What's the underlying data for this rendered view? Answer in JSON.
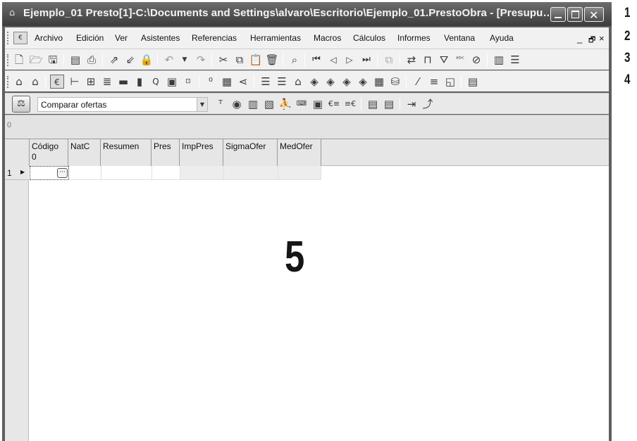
{
  "window": {
    "title": "Ejemplo_01 Presto[1]-C:\\Documents and Settings\\alvaro\\Escritorio\\Ejemplo_01.PrestoObra - [Presupu…"
  },
  "menubar": {
    "items": [
      "Archivo",
      "Edición",
      "Ver",
      "Asistentes",
      "Referencias",
      "Herramientas",
      "Macros",
      "Cálculos",
      "Informes",
      "Ventana",
      "Ayuda"
    ],
    "mdi_controls": [
      "_",
      "🗗",
      "×"
    ]
  },
  "toolbar_compare": {
    "selected": "Comparar ofertas"
  },
  "filter": {
    "value": "0"
  },
  "grid": {
    "columns": [
      {
        "label": "Código",
        "sub": "0"
      },
      {
        "label": "NatC",
        "sub": ""
      },
      {
        "label": "Resumen",
        "sub": ""
      },
      {
        "label": "Pres",
        "sub": ""
      },
      {
        "label": "ImpPres",
        "sub": ""
      },
      {
        "label": "SigmaOfer",
        "sub": ""
      },
      {
        "label": "MedOfer",
        "sub": ""
      }
    ],
    "row_number": "1",
    "ellipsis": "···"
  },
  "callouts": [
    "1",
    "2",
    "3",
    "4",
    "5"
  ],
  "icons": {
    "toolbar_standard": [
      "new-icon",
      "open-icon",
      "save-icon",
      "preview-icon",
      "print-icon",
      "export-icon",
      "import-icon",
      "lock-icon",
      "undo-icon",
      "dropdown-icon",
      "redo-icon",
      "cut-icon",
      "copy-icon",
      "paste-icon",
      "delete-icon",
      "find-icon",
      "first-icon",
      "prev-icon",
      "next-icon",
      "last-icon",
      "clone-icon",
      "recalc-icon",
      "ruler-icon",
      "filter-icon",
      "spell-icon",
      "no-filter-icon",
      "columns-icon",
      "rows-icon"
    ]
  },
  "colors": {
    "titlebar": "#4a4a4a",
    "panel": "#f1f1f1",
    "grid_header": "#e6e6e6"
  }
}
